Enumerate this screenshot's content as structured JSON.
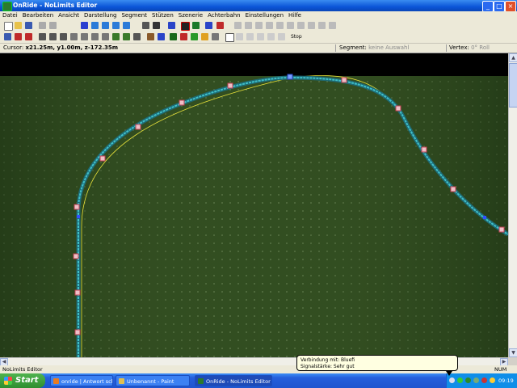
{
  "window": {
    "title": "OnRide - NoLimits Editor"
  },
  "menu": [
    "Datei",
    "Bearbeiten",
    "Ansicht",
    "Darstellung",
    "Segment",
    "Stützen",
    "Szenerie",
    "Achterbahn",
    "Einstellungen",
    "Hilfe"
  ],
  "toolbar2_text": {
    "stop": "Stop"
  },
  "status": {
    "cursor_label": "Cursor:",
    "cursor_value": "x21.25m, y1.00m, z-172.35m",
    "segment_label": "Segment:",
    "segment_value": "keine Auswahl",
    "vertex_label": "Vertex:",
    "vertex_value": "0° Roll"
  },
  "bottom_status": {
    "left": "NoLimits Editor",
    "num": "NUM"
  },
  "balloon": {
    "line1": "Verbindung mit: Bluefi",
    "line2": "Signalstärke: Sehr gut"
  },
  "taskbar": {
    "start": "Start",
    "tasks": [
      {
        "label": "onride | Antwort schr...",
        "icon": "firefox-icon"
      },
      {
        "label": "Unbenannt - Paint",
        "icon": "paint-icon"
      },
      {
        "label": "OnRide - NoLimits Editor",
        "icon": "nolimits-icon"
      }
    ],
    "clock": "09:19"
  },
  "colors": {
    "grass": "#2e4a1e",
    "track": "#3fc0c8",
    "track_guide": "#e8e23a",
    "node": "#c04050",
    "xp_blue": "#245edb"
  }
}
